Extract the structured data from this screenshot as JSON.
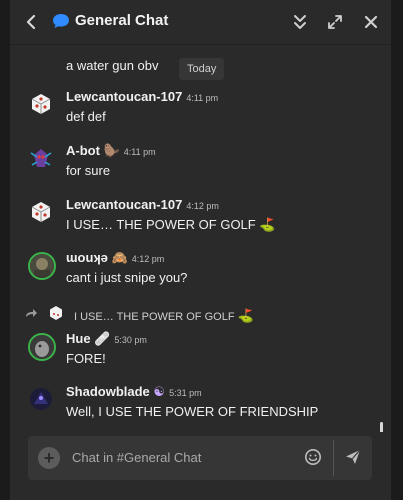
{
  "header": {
    "title": "General Chat",
    "icons": [
      "back-icon",
      "chat-bubble-icon",
      "collapse-icon",
      "expand-icon",
      "close-icon"
    ]
  },
  "messages": [
    {
      "text": "a water gun obv",
      "date_chip": "Today"
    },
    {
      "name": "Lewcantoucan-107",
      "time": "4:11 pm",
      "text": "def def",
      "avatar": "dice-avatar"
    },
    {
      "name": "A-bot",
      "emoji": "🦫",
      "time": "4:11 pm",
      "text": "for sure",
      "avatar": "robot-avatar"
    },
    {
      "name": "Lewcantoucan-107",
      "time": "4:12 pm",
      "text": "I USE… THE POWER OF GOLF",
      "emoji": "⛳",
      "avatar": "dice-avatar"
    },
    {
      "name": "ɯouʞǝ",
      "emoji": "🙈",
      "time": "4:12 pm",
      "text": "cant i just snipe you?",
      "avatar": "photo-avatar"
    },
    {
      "reply_text": "I USE… THE POWER OF GOLF",
      "reply_emoji": "⛳"
    },
    {
      "name": "Hue",
      "emoji": "🩹",
      "time": "5:30 pm",
      "text": "FORE!",
      "avatar": "grey-avatar"
    },
    {
      "name": "Shadowblade",
      "emoji": "☯",
      "time": "5:31 pm",
      "text": "Well, I USE THE POWER OF FRIENDSHIP",
      "avatar": "dark-avatar"
    }
  ],
  "composer": {
    "placeholder": "Chat in #General Chat",
    "add_label": "+"
  },
  "colors": {
    "background": "#2a2a2a",
    "chat_icon": "#2f8bff",
    "golf_flag": "#e23b3b",
    "golf_green": "#4caf50"
  }
}
